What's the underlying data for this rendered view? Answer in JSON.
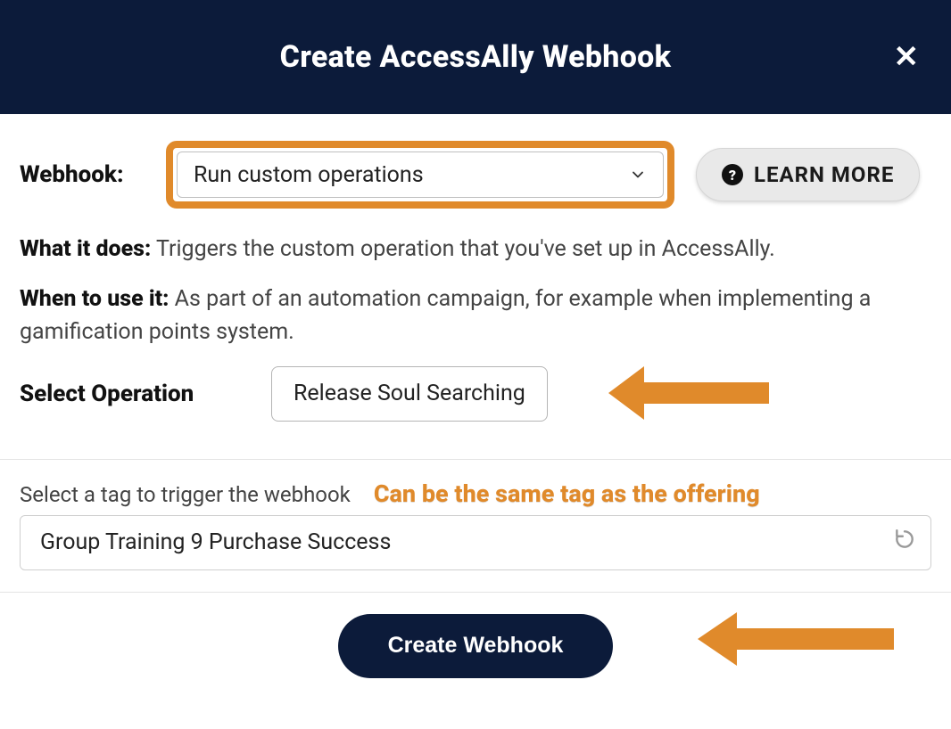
{
  "header": {
    "title": "Create AccessAlly Webhook"
  },
  "form": {
    "webhook_label": "Webhook:",
    "webhook_select_value": "Run custom operations",
    "learn_more_label": "LEARN MORE",
    "what_label": "What it does:",
    "what_text": "Triggers the custom operation that you've set up in AccessAlly.",
    "when_label": "When to use it:",
    "when_text": "As part of an automation campaign, for example when implementing a gamification points system.",
    "select_operation_label": "Select Operation",
    "operation_value": "Release Soul Searching",
    "tag_label": "Select a tag to trigger the webhook",
    "tag_value": "Group Training 9 Purchase Success",
    "create_button": "Create Webhook"
  },
  "annotations": {
    "tag_hint": "Can be the same tag as the offering"
  },
  "colors": {
    "accent": "#e08a2b",
    "dark": "#0c1b3a"
  }
}
